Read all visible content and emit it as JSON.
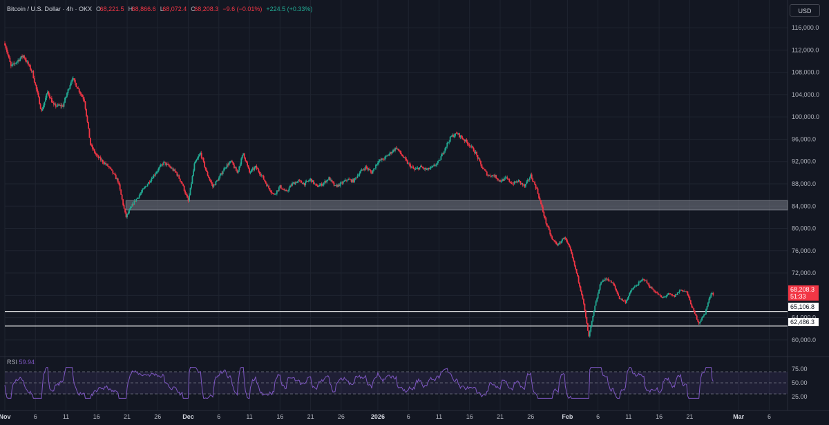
{
  "header": {
    "symbol": "Bitcoin / U.S. Dollar · 4h · OKX",
    "o_key": "O",
    "o_val": "68,221.5",
    "h_key": "H",
    "h_val": "68,866.6",
    "l_key": "L",
    "l_val": "68,072.4",
    "c_key": "C",
    "c_val": "68,208.3",
    "change": "−9.6 (−0.01%)",
    "change2": "+224.5 (+0.33%)"
  },
  "currency_button": "USD",
  "current_price": {
    "price": "68,208.3",
    "countdown": "51:33"
  },
  "levels": [
    {
      "label": "65,106.8",
      "value": 65106.8
    },
    {
      "label": "62,486.3",
      "value": 62486.3
    }
  ],
  "rsi": {
    "label": "RSI",
    "value": "59.94"
  },
  "colors": {
    "bg": "#131722",
    "up": "#22ab94",
    "down": "#f23645",
    "rsi": "#7e57c2",
    "zone": "#787b86"
  },
  "chart_data": [
    {
      "type": "candlestick",
      "ylim": [
        58000,
        117500
      ],
      "ylabel_ticks": [
        {
          "v": 116000,
          "t": "116,000.0"
        },
        {
          "v": 112000,
          "t": "112,000.0"
        },
        {
          "v": 108000,
          "t": "108,000.0"
        },
        {
          "v": 104000,
          "t": "104,000.0"
        },
        {
          "v": 100000,
          "t": "100,000.0"
        },
        {
          "v": 96000,
          "t": "96,000.0"
        },
        {
          "v": 92000,
          "t": "92,000.0"
        },
        {
          "v": 88000,
          "t": "88,000.0"
        },
        {
          "v": 84000,
          "t": "84,000.0"
        },
        {
          "v": 80000,
          "t": "80,000.0"
        },
        {
          "v": 76000,
          "t": "76,000.0"
        },
        {
          "v": 72000,
          "t": "72,000.0"
        },
        {
          "v": 68000,
          "t": "68,000.0"
        },
        {
          "v": 64000,
          "t": "64,000.0"
        },
        {
          "v": 60000,
          "t": "60,000.0"
        }
      ],
      "x_ticks": [
        {
          "d": 0,
          "t": "Nov"
        },
        {
          "d": 5,
          "t": "6"
        },
        {
          "d": 10,
          "t": "11"
        },
        {
          "d": 15,
          "t": "16"
        },
        {
          "d": 20,
          "t": "21"
        },
        {
          "d": 25,
          "t": "26"
        },
        {
          "d": 30,
          "t": "Dec"
        },
        {
          "d": 35,
          "t": "6"
        },
        {
          "d": 40,
          "t": "11"
        },
        {
          "d": 45,
          "t": "16"
        },
        {
          "d": 50,
          "t": "21"
        },
        {
          "d": 55,
          "t": "26"
        },
        {
          "d": 61,
          "t": "2026"
        },
        {
          "d": 66,
          "t": "6"
        },
        {
          "d": 71,
          "t": "11"
        },
        {
          "d": 76,
          "t": "16"
        },
        {
          "d": 81,
          "t": "21"
        },
        {
          "d": 86,
          "t": "26"
        },
        {
          "d": 92,
          "t": "Feb"
        },
        {
          "d": 97,
          "t": "6"
        },
        {
          "d": 102,
          "t": "11"
        },
        {
          "d": 107,
          "t": "16"
        },
        {
          "d": 112,
          "t": "21"
        },
        {
          "d": 120,
          "t": "Mar"
        },
        {
          "d": 125,
          "t": "6"
        }
      ],
      "zone": [
        83300,
        85000
      ],
      "anchors": [
        [
          0,
          113200
        ],
        [
          1,
          109000
        ],
        [
          3,
          111000
        ],
        [
          4.5,
          108000
        ],
        [
          6,
          101000
        ],
        [
          7,
          104500
        ],
        [
          8,
          102000
        ],
        [
          9.5,
          102000
        ],
        [
          11,
          107000
        ],
        [
          12,
          105000
        ],
        [
          13,
          103000
        ],
        [
          14,
          95000
        ],
        [
          15,
          93000
        ],
        [
          17,
          91000
        ],
        [
          18.5,
          88500
        ],
        [
          19.8,
          82000
        ],
        [
          21,
          84500
        ],
        [
          22,
          86000
        ],
        [
          23,
          87500
        ],
        [
          24,
          89000
        ],
        [
          25,
          90500
        ],
        [
          26,
          91800
        ],
        [
          27,
          91000
        ],
        [
          28,
          90000
        ],
        [
          29,
          88000
        ],
        [
          30,
          84800
        ],
        [
          31,
          91500
        ],
        [
          32,
          93500
        ],
        [
          33,
          90000
        ],
        [
          34,
          87500
        ],
        [
          35,
          89000
        ],
        [
          36,
          91000
        ],
        [
          37,
          92000
        ],
        [
          38,
          90000
        ],
        [
          39,
          93500
        ],
        [
          40,
          90000
        ],
        [
          41,
          91000
        ],
        [
          42,
          89500
        ],
        [
          43,
          87500
        ],
        [
          44,
          86000
        ],
        [
          45,
          87500
        ],
        [
          46,
          86500
        ],
        [
          47,
          88000
        ],
        [
          48,
          88500
        ],
        [
          49,
          88000
        ],
        [
          50,
          88800
        ],
        [
          51,
          87500
        ],
        [
          52,
          88000
        ],
        [
          53,
          89000
        ],
        [
          54,
          87500
        ],
        [
          55,
          88000
        ],
        [
          56,
          88800
        ],
        [
          57,
          88500
        ],
        [
          58,
          90000
        ],
        [
          59,
          91000
        ],
        [
          60,
          90000
        ],
        [
          61,
          92000
        ],
        [
          62,
          92500
        ],
        [
          63,
          93500
        ],
        [
          64,
          94500
        ],
        [
          65,
          93000
        ],
        [
          66,
          91500
        ],
        [
          67,
          90500
        ],
        [
          68,
          91000
        ],
        [
          69,
          90500
        ],
        [
          70,
          91000
        ],
        [
          71,
          92000
        ],
        [
          72,
          94500
        ],
        [
          73,
          96500
        ],
        [
          74,
          97000
        ],
        [
          75,
          96000
        ],
        [
          76,
          95000
        ],
        [
          77,
          93500
        ],
        [
          78,
          91000
        ],
        [
          79,
          89500
        ],
        [
          80,
          89500
        ],
        [
          81,
          88500
        ],
        [
          82,
          89000
        ],
        [
          83,
          88000
        ],
        [
          84,
          88500
        ],
        [
          85,
          87500
        ],
        [
          86,
          89500
        ],
        [
          87,
          87000
        ],
        [
          87.5,
          85000
        ],
        [
          88.5,
          81000
        ],
        [
          89.5,
          78000
        ],
        [
          90.5,
          77000
        ],
        [
          91.5,
          78500
        ],
        [
          92.5,
          76000
        ],
        [
          93.5,
          72000
        ],
        [
          94.5,
          67500
        ],
        [
          95.5,
          60500
        ],
        [
          96.5,
          66000
        ],
        [
          97.5,
          70500
        ],
        [
          98.5,
          71000
        ],
        [
          99.5,
          70000
        ],
        [
          100.5,
          67500
        ],
        [
          101.5,
          66800
        ],
        [
          102.5,
          69000
        ],
        [
          103.5,
          70000
        ],
        [
          104.5,
          71000
        ],
        [
          105.5,
          69500
        ],
        [
          106.5,
          68500
        ],
        [
          107.5,
          67500
        ],
        [
          108.5,
          68200
        ],
        [
          109.5,
          67800
        ],
        [
          110.5,
          69000
        ],
        [
          111.5,
          68600
        ],
        [
          112.5,
          65500
        ],
        [
          113.5,
          63000
        ],
        [
          114.5,
          64800
        ],
        [
          115.5,
          68500
        ],
        [
          115.9,
          68208
        ]
      ]
    },
    {
      "type": "line",
      "name": "RSI",
      "ylim": [
        20,
        80
      ],
      "band": [
        30,
        70
      ],
      "ylabel_ticks": [
        {
          "v": 75,
          "t": "75.00"
        },
        {
          "v": 50,
          "t": "50.00"
        },
        {
          "v": 25,
          "t": "25.00"
        }
      ]
    }
  ]
}
